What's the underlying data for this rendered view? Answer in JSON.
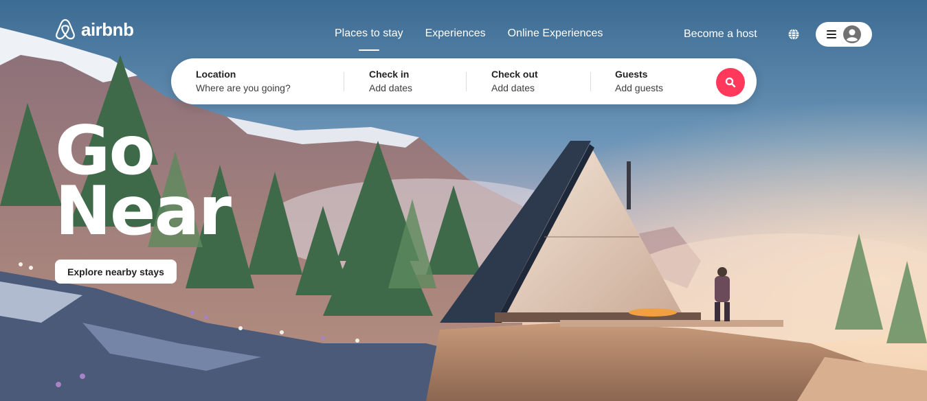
{
  "brand": {
    "name": "airbnb",
    "logo_icon": "airbnb-logo-icon"
  },
  "nav": {
    "items": [
      {
        "label": "Places to stay",
        "active": true
      },
      {
        "label": "Experiences",
        "active": false
      },
      {
        "label": "Online Experiences",
        "active": false
      }
    ]
  },
  "header": {
    "become_host": "Become a host",
    "globe_icon": "globe-icon",
    "menu_icon": "hamburger-menu-icon",
    "avatar_icon": "user-avatar-icon"
  },
  "search": {
    "location": {
      "label": "Location",
      "placeholder": "Where are you going?"
    },
    "check_in": {
      "label": "Check in",
      "placeholder": "Add dates"
    },
    "check_out": {
      "label": "Check out",
      "placeholder": "Add dates"
    },
    "guests": {
      "label": "Guests",
      "placeholder": "Add guests"
    },
    "button_icon": "search-icon"
  },
  "hero": {
    "headline_line1": "Go",
    "headline_line2": "Near",
    "cta_label": "Explore nearby stays"
  },
  "colors": {
    "brand": "#ff385c",
    "sky_top": "#3e6f97",
    "sky_bottom": "#f2c6a8"
  }
}
